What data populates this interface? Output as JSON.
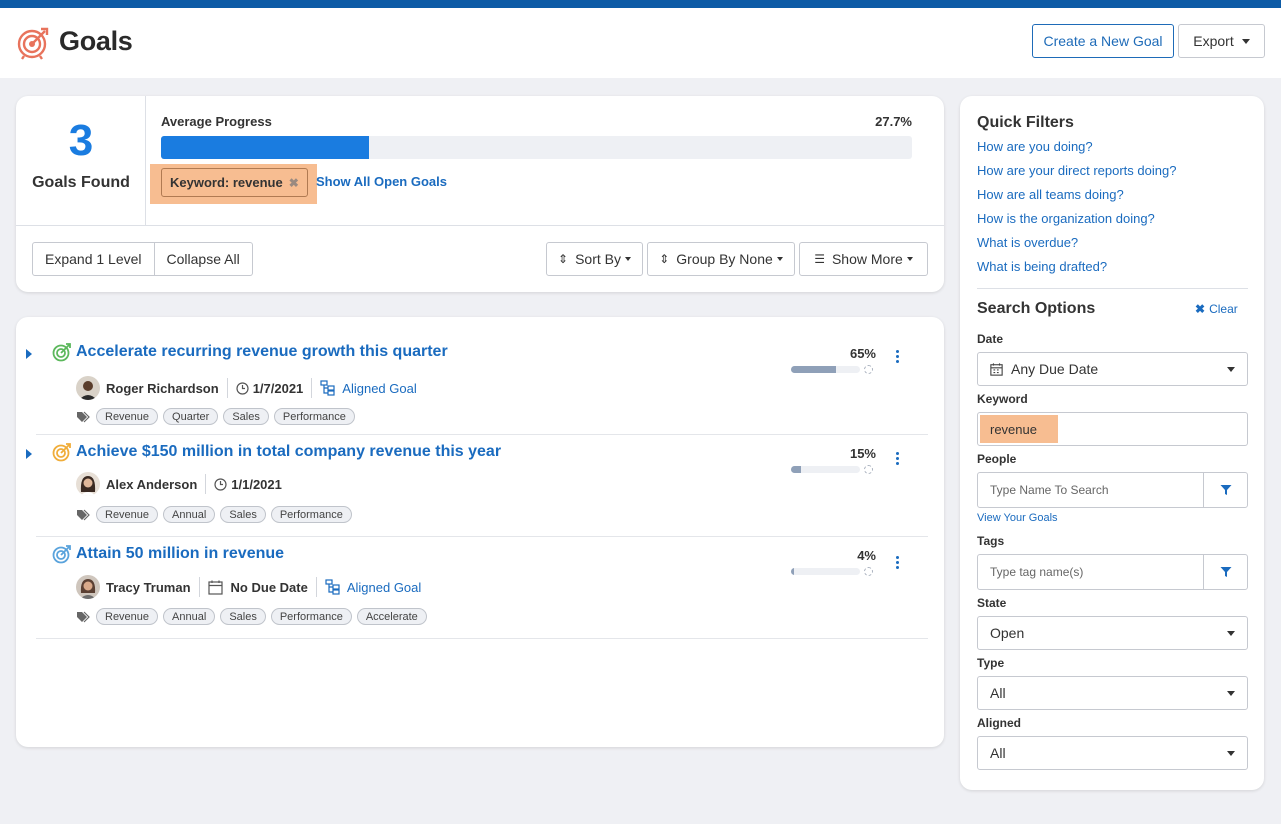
{
  "header": {
    "title": "Goals",
    "create_label": "Create a New Goal",
    "export_label": "Export"
  },
  "summary": {
    "count": "3",
    "count_label": "Goals Found",
    "avg_label": "Average Progress",
    "avg_value": "27.7%",
    "avg_progress": 0.277,
    "keyword_chip": "Keyword: revenue",
    "show_all": "Show All Open Goals",
    "expand_label": "Expand 1 Level",
    "collapse_label": "Collapse All",
    "sort_label": "Sort By",
    "group_label": "Group By None",
    "show_more_label": "Show More"
  },
  "goals": [
    {
      "title": "Accelerate recurring revenue growth this quarter",
      "owner": "Roger Richardson",
      "date": "1/7/2021",
      "aligned": "Aligned Goal",
      "tags": [
        "Revenue",
        "Quarter",
        "Sales",
        "Performance"
      ],
      "percent": "65%",
      "progress": 0.65
    },
    {
      "title": "Achieve $150 million in total company revenue this year",
      "owner": "Alex Anderson",
      "date": "1/1/2021",
      "aligned": "",
      "tags": [
        "Revenue",
        "Annual",
        "Sales",
        "Performance"
      ],
      "percent": "15%",
      "progress": 0.15
    },
    {
      "title": "Attain 50 million in revenue",
      "owner": "Tracy Truman",
      "date": "No Due Date",
      "aligned": "Aligned Goal",
      "tags": [
        "Revenue",
        "Annual",
        "Sales",
        "Performance",
        "Accelerate"
      ],
      "percent": "4%",
      "progress": 0.04
    }
  ],
  "quick_filters": {
    "title": "Quick Filters",
    "links": [
      "How are you doing?",
      "How are your direct reports doing?",
      "How are all teams doing?",
      "How is the organization doing?",
      "What is overdue?",
      "What is being drafted?"
    ]
  },
  "search": {
    "title": "Search Options",
    "clear_label": "Clear",
    "date_label": "Date",
    "date_value": "Any Due Date",
    "keyword_label": "Keyword",
    "keyword_value": "revenue",
    "people_label": "People",
    "people_placeholder": "Type Name To Search",
    "view_your_goals": "View Your Goals",
    "tags_label": "Tags",
    "tags_placeholder": "Type tag name(s)",
    "state_label": "State",
    "state_value": "Open",
    "type_label": "Type",
    "type_value": "All",
    "aligned_label": "Aligned",
    "aligned_value": "All"
  },
  "colors": {
    "accent": "#1a6bbf",
    "brand_bar": "#0d5ba6",
    "highlight": "#f7bd91",
    "progress": "#1a7ce0"
  }
}
